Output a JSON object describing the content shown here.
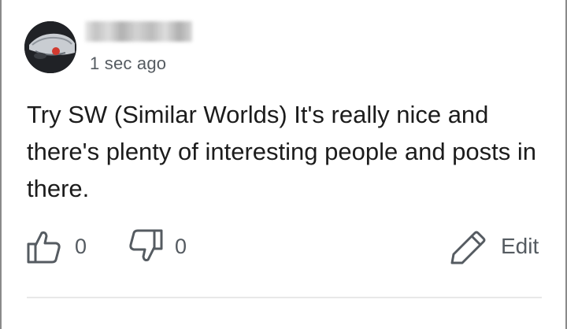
{
  "comment": {
    "timestamp": "1 sec ago",
    "body": "Try SW (Similar Worlds) It's really nice and there's plenty of interesting people and posts in there."
  },
  "actions": {
    "like_count": "0",
    "dislike_count": "0",
    "edit_label": "Edit"
  },
  "icons": {
    "like": "thumbs-up-icon",
    "dislike": "thumbs-down-icon",
    "edit": "pencil-icon"
  },
  "colors": {
    "icon_gray": "#555b61",
    "text": "#1c1c1c"
  }
}
